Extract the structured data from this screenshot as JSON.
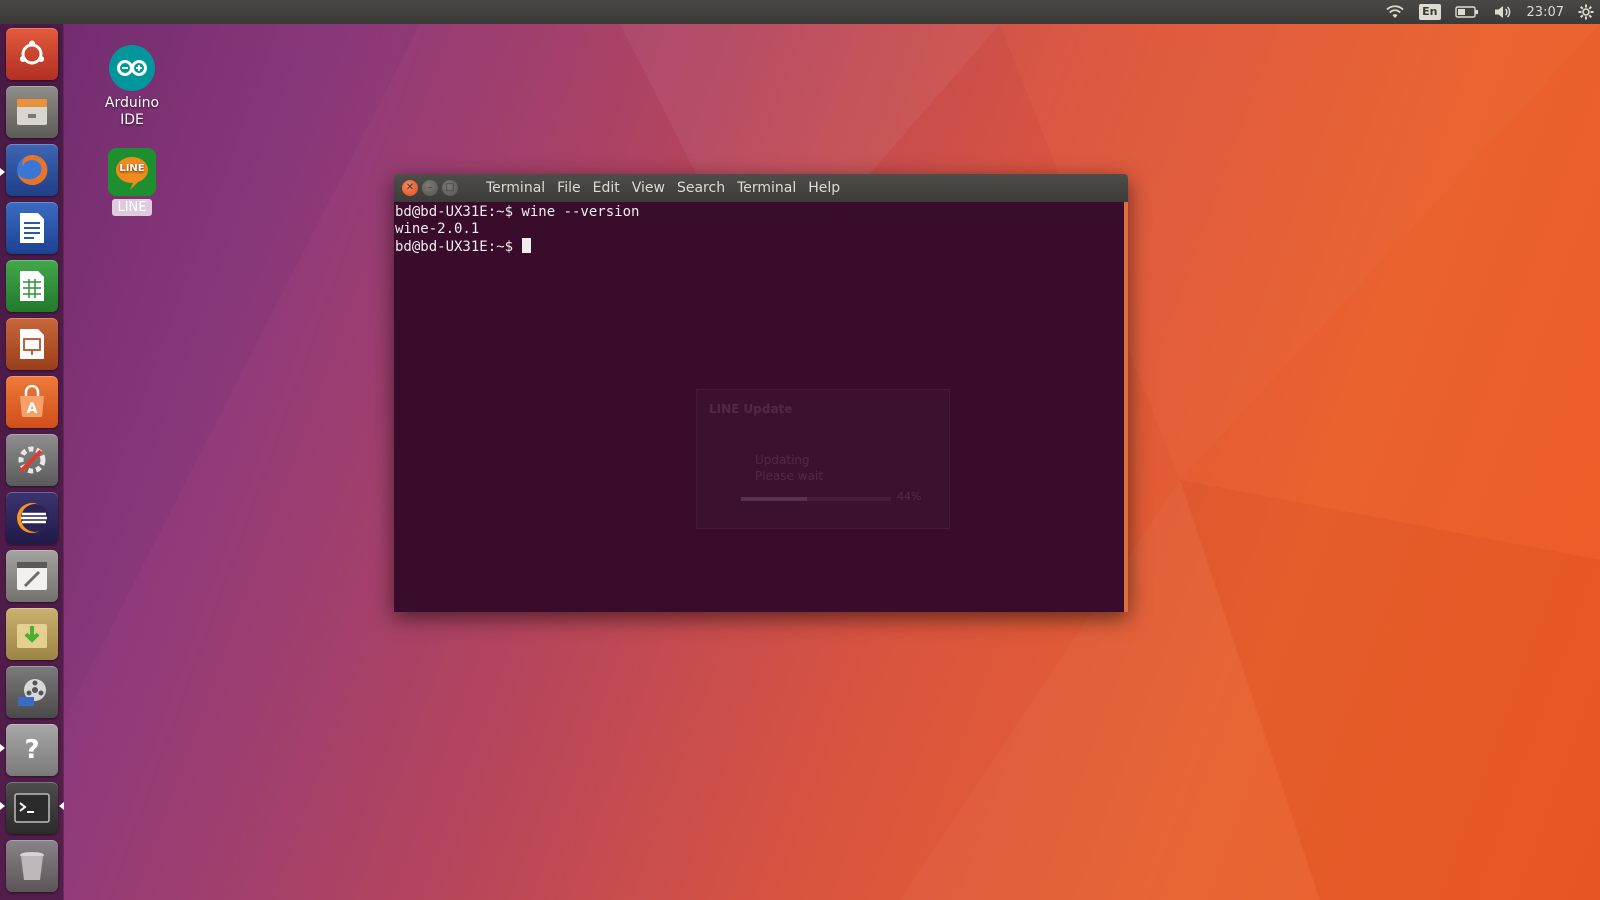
{
  "top_panel": {
    "keyboard_layout": "En",
    "clock": "23:07",
    "icons": [
      "wifi-icon",
      "battery-icon",
      "volume-icon",
      "session-gear-icon"
    ]
  },
  "launcher": {
    "items": [
      {
        "name": "ubuntu-dash",
        "color": "#c0392b"
      },
      {
        "name": "files",
        "color": "#7c7a76"
      },
      {
        "name": "firefox",
        "color": "#e2682c",
        "running": true
      },
      {
        "name": "libreoffice-writer",
        "color": "#1f4f9c"
      },
      {
        "name": "libreoffice-calc",
        "color": "#2f8f3a"
      },
      {
        "name": "libreoffice-impress",
        "color": "#b5532a"
      },
      {
        "name": "ubuntu-software",
        "color": "#e8632a"
      },
      {
        "name": "system-settings",
        "color": "#8a8a8a"
      },
      {
        "name": "eclipse",
        "color": "#2c2255"
      },
      {
        "name": "system-tools",
        "color": "#9a9894"
      },
      {
        "name": "archive-manager",
        "color": "#b79d5b"
      },
      {
        "name": "media-tools",
        "color": "#6a6a6a"
      },
      {
        "name": "help",
        "color": "#8f8f8f",
        "label": "?",
        "running": true
      },
      {
        "name": "terminal",
        "color": "#2d2d2d",
        "running": true,
        "active": true
      },
      {
        "name": "trash",
        "color": "#6f6a6e"
      }
    ]
  },
  "desktop": {
    "icons": [
      {
        "label": "Arduino IDE",
        "color": "#00979c"
      },
      {
        "label": "LINE",
        "color": "#1e8f2e",
        "badge": "LINE"
      }
    ]
  },
  "terminal": {
    "menu": [
      "Terminal",
      "File",
      "Edit",
      "View",
      "Search",
      "Terminal",
      "Help"
    ],
    "lines": [
      "bd@bd-UX31E:~$ wine --version",
      "wine-2.0.1",
      "bd@bd-UX31E:~$ "
    ]
  },
  "background_dialog": {
    "title": "LINE Update",
    "message_line1": "Updating",
    "message_line2": "Please wait",
    "progress_percent": 44,
    "progress_label": "44%"
  }
}
